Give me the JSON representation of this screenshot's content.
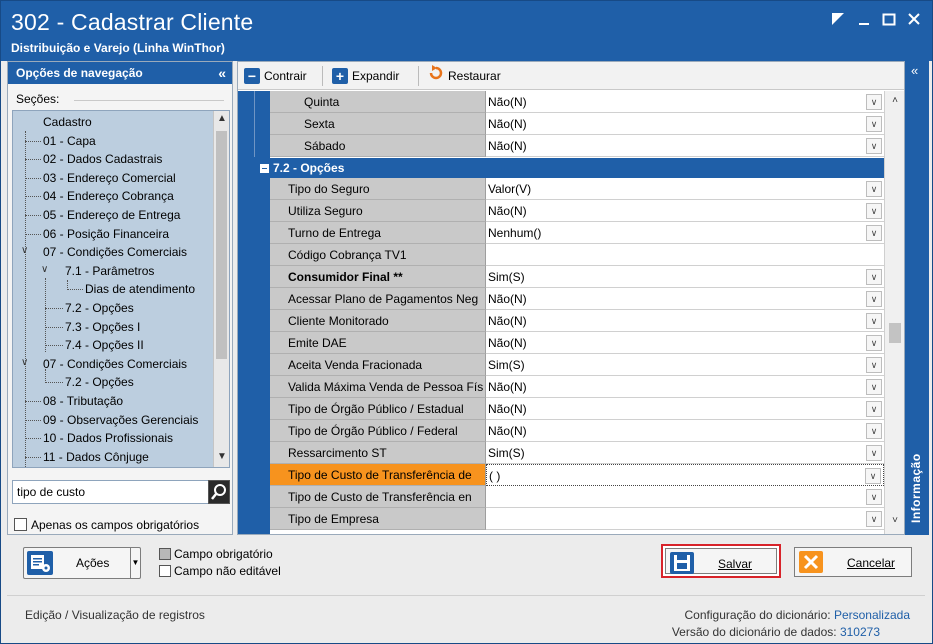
{
  "window": {
    "title": "302 - Cadastrar Cliente",
    "subtitle": "Distribuição e Varejo (Linha WinThor)",
    "controls": [
      "restore",
      "minimize",
      "maximize",
      "close"
    ]
  },
  "nav": {
    "header": "Opções de navegação",
    "collapse_glyph": "«",
    "sections_label": "Seções:",
    "tree": [
      {
        "label": "Cadastro",
        "level": 0
      },
      {
        "label": "01 - Capa",
        "level": 1
      },
      {
        "label": "02 - Dados Cadastrais",
        "level": 1
      },
      {
        "label": "03 - Endereço Comercial",
        "level": 1
      },
      {
        "label": "04 - Endereço Cobrança",
        "level": 1
      },
      {
        "label": "05 - Endereço de Entrega",
        "level": 1
      },
      {
        "label": "06 - Posição Financeira",
        "level": 1
      },
      {
        "label": "07 - Condições Comerciais",
        "level": 1,
        "expanded": true
      },
      {
        "label": "7.1 - Parâmetros",
        "level": 2,
        "expanded": true
      },
      {
        "label": "Dias de atendimento",
        "level": 3
      },
      {
        "label": "7.2 - Opções",
        "level": 2
      },
      {
        "label": "7.3 - Opções I",
        "level": 2
      },
      {
        "label": "7.4 - Opções II",
        "level": 2
      },
      {
        "label": "07 - Condições Comerciais",
        "level": 1,
        "expanded": true
      },
      {
        "label": "7.2 - Opções",
        "level": 2
      },
      {
        "label": "08 - Tributação",
        "level": 1
      },
      {
        "label": "09 - Observações Gerenciais",
        "level": 1
      },
      {
        "label": "10 - Dados Profissionais",
        "level": 1
      },
      {
        "label": "11 - Dados Cônjuge",
        "level": 1
      }
    ],
    "search_value": "tipo de custo",
    "required_only_label": "Apenas os campos obrigatórios"
  },
  "toolbar": {
    "contrair": "Contrair",
    "expandir": "Expandir",
    "restaurar": "Restaurar"
  },
  "grid": {
    "rows_top": [
      {
        "label": "Quinta",
        "value": "Não(N)"
      },
      {
        "label": "Sexta",
        "value": "Não(N)"
      },
      {
        "label": "Sábado",
        "value": "Não(N)"
      }
    ],
    "section": "7.2 - Opções",
    "rows": [
      {
        "label": "Tipo do Seguro",
        "value": "Valor(V)",
        "dropdown": true
      },
      {
        "label": "Utiliza Seguro",
        "value": "Não(N)",
        "dropdown": true
      },
      {
        "label": "Turno de Entrega",
        "value": "Nenhum()",
        "dropdown": true
      },
      {
        "label": "Código Cobrança TV1",
        "value": "",
        "dropdown": false
      },
      {
        "label": "Consumidor Final **",
        "value": "Sim(S)",
        "dropdown": true,
        "bold": true
      },
      {
        "label": "Acessar Plano de Pagamentos Neg",
        "value": "Não(N)",
        "dropdown": true
      },
      {
        "label": "Cliente Monitorado",
        "value": "Não(N)",
        "dropdown": true
      },
      {
        "label": "Emite DAE",
        "value": "Não(N)",
        "dropdown": true
      },
      {
        "label": "Aceita Venda Fracionada",
        "value": "Sim(S)",
        "dropdown": true
      },
      {
        "label": "Valida Máxima Venda de Pessoa Fís",
        "value": "Não(N)",
        "dropdown": true
      },
      {
        "label": "Tipo de Órgão Público / Estadual",
        "value": "Não(N)",
        "dropdown": true
      },
      {
        "label": "Tipo de Órgão Público / Federal",
        "value": "Não(N)",
        "dropdown": true
      },
      {
        "label": "Ressarcimento ST",
        "value": "Sim(S)",
        "dropdown": true
      },
      {
        "label": "Tipo de Custo de Transferência de",
        "value": "( )",
        "dropdown": true,
        "selected": true
      },
      {
        "label": "Tipo de Custo de Transferência en",
        "value": "",
        "dropdown": true
      },
      {
        "label": "Tipo de Empresa",
        "value": "",
        "dropdown": true
      }
    ]
  },
  "side_tab": {
    "label": "Informação",
    "glyph": "«"
  },
  "actions": {
    "acoes": "Ações",
    "legend_required": "Campo obrigatório",
    "legend_readonly": "Campo não editável",
    "salvar": "Salvar",
    "cancelar": "Cancelar"
  },
  "status": {
    "mode": "Edição / Visualização de registros",
    "dict_config_label": "Configuração do dicionário:",
    "dict_config_value": "Personalizada",
    "dict_version_label": "Versão do dicionário de dados:",
    "dict_version_value": "310273"
  },
  "colors": {
    "brand_blue": "#1f5fa8",
    "selected_row": "#f7931e",
    "save_highlight": "#d8232a"
  }
}
